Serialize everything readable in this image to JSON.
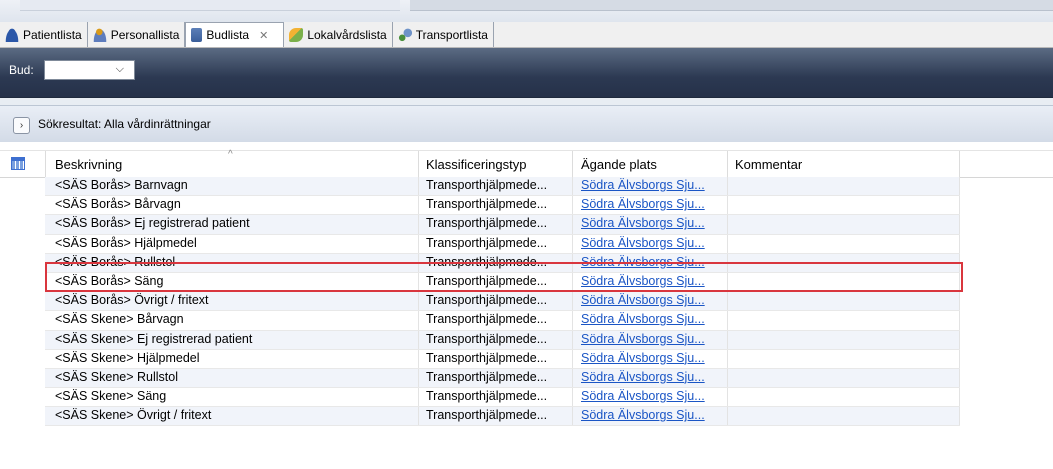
{
  "tabs": [
    {
      "label": "Patientlista",
      "icon": "patient-icon"
    },
    {
      "label": "Personallista",
      "icon": "personnel-icon"
    },
    {
      "label": "Budlista",
      "icon": "courier-list-icon",
      "active": true,
      "close": "✕"
    },
    {
      "label": "Lokalvårdslista",
      "icon": "cleaning-icon"
    },
    {
      "label": "Transportlista",
      "icon": "transport-icon"
    }
  ],
  "bud": {
    "label": "Bud:",
    "value": "",
    "chevron": "⌵"
  },
  "results": {
    "toggle": "›",
    "title": "Sökresultat: Alla vårdinrättningar"
  },
  "grid": {
    "columns": [
      "Beskrivning",
      "Klassificeringstyp",
      "Ägande plats",
      "Kommentar"
    ],
    "sort_indicator": "^",
    "rows": [
      {
        "desc": "<SÄS Borås> Barnvagn",
        "type": "Transporthjälpmede...",
        "place": "Södra Älvsborgs Sju...",
        "comment": ""
      },
      {
        "desc": "<SÄS Borås> Bårvagn",
        "type": "Transporthjälpmede...",
        "place": "Södra Älvsborgs Sju...",
        "comment": ""
      },
      {
        "desc": "<SÄS Borås> Ej registrerad patient",
        "type": "Transporthjälpmede...",
        "place": "Södra Älvsborgs Sju...",
        "comment": ""
      },
      {
        "desc": "<SÄS Borås> Hjälpmedel",
        "type": "Transporthjälpmede...",
        "place": "Södra Älvsborgs Sju...",
        "comment": ""
      },
      {
        "desc": "<SÄS Borås> Rullstol",
        "type": "Transporthjälpmede...",
        "place": "Södra Älvsborgs Sju...",
        "comment": "",
        "highlighted": true
      },
      {
        "desc": "<SÄS Borås> Säng",
        "type": "Transporthjälpmede...",
        "place": "Södra Älvsborgs Sju...",
        "comment": ""
      },
      {
        "desc": "<SÄS Borås> Övrigt / fritext",
        "type": "Transporthjälpmede...",
        "place": "Södra Älvsborgs Sju...",
        "comment": ""
      },
      {
        "desc": "<SÄS Skene> Bårvagn",
        "type": "Transporthjälpmede...",
        "place": "Södra Älvsborgs Sju...",
        "comment": ""
      },
      {
        "desc": "<SÄS Skene> Ej registrerad patient",
        "type": "Transporthjälpmede...",
        "place": "Södra Älvsborgs Sju...",
        "comment": ""
      },
      {
        "desc": "<SÄS Skene> Hjälpmedel",
        "type": "Transporthjälpmede...",
        "place": "Södra Älvsborgs Sju...",
        "comment": ""
      },
      {
        "desc": "<SÄS Skene> Rullstol",
        "type": "Transporthjälpmede...",
        "place": "Södra Älvsborgs Sju...",
        "comment": ""
      },
      {
        "desc": "<SÄS Skene> Säng",
        "type": "Transporthjälpmede...",
        "place": "Södra Älvsborgs Sju...",
        "comment": ""
      },
      {
        "desc": "<SÄS Skene> Övrigt / fritext",
        "type": "Transporthjälpmede...",
        "place": "Södra Älvsborgs Sju...",
        "comment": ""
      }
    ]
  },
  "colors": {
    "highlight": "#d9363e",
    "link": "#1a55c5",
    "header_dark": "#2c3952"
  }
}
